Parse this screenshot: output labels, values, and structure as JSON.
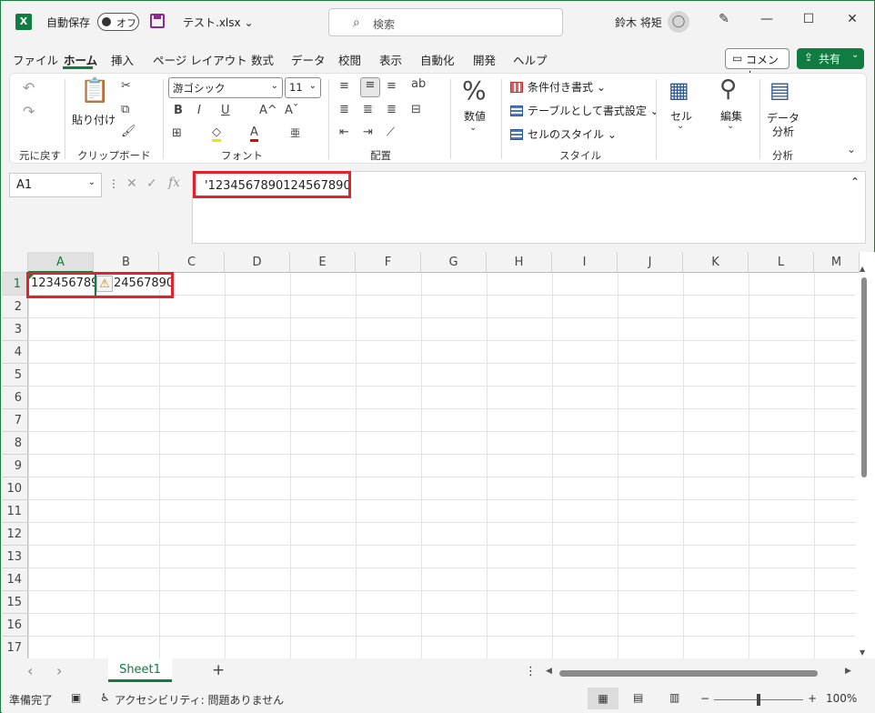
{
  "app": {
    "logo": "X",
    "autosave_label": "自動保存",
    "autosave_state": "オフ",
    "filename": "テスト.xlsx",
    "filename_chevron": "⌄",
    "search_placeholder": "検索",
    "user_name": "鈴木 将矩",
    "minimize": "—",
    "maximize": "☐",
    "close": "✕"
  },
  "menu": {
    "tabs": [
      "ファイル",
      "ホーム",
      "挿入",
      "ページ レイアウト",
      "数式",
      "データ",
      "校閲",
      "表示",
      "自動化",
      "開発",
      "ヘルプ"
    ],
    "active_tab": "ホーム",
    "comment_button": "コメント",
    "share_button": "共有"
  },
  "ribbon": {
    "groups": {
      "undo": "元に戻す",
      "clipboard": "クリップボード",
      "font": "フォント",
      "alignment": "配置",
      "styles": "スタイル",
      "analysis": "分析"
    },
    "paste_label": "貼り付け",
    "font_name": "游ゴシック",
    "font_size": "11",
    "bold": "B",
    "italic": "I",
    "underline": "U",
    "grow_font": "A^",
    "shrink_font": "Aˇ",
    "number_label": "数値",
    "number_symbol": "%",
    "conditional_format": "条件付き書式",
    "format_as_table": "テーブルとして書式設定",
    "cell_styles": "セルのスタイル",
    "cells_label": "セル",
    "edit_label": "編集",
    "data_analysis_label1": "データ",
    "data_analysis_label2": "分析"
  },
  "formula_bar": {
    "name_box": "A1",
    "fx": "fx",
    "cancel": "✕",
    "enter": "✓",
    "formula": "'1234567890124567890"
  },
  "grid": {
    "columns": [
      "A",
      "B",
      "C",
      "D",
      "E",
      "F",
      "G",
      "H",
      "I",
      "J",
      "K",
      "L",
      "M"
    ],
    "rows": [
      "1",
      "2",
      "3",
      "4",
      "5",
      "6",
      "7",
      "8",
      "9",
      "10",
      "11",
      "12",
      "13",
      "14",
      "15",
      "16",
      "17"
    ],
    "cell_a1_visible": "123456789",
    "cell_overflow_visible": "24567890",
    "warning_symbol": "⚠"
  },
  "sheets": {
    "tabs": [
      "Sheet1"
    ],
    "add": "+",
    "prev": "‹",
    "next": "›",
    "more": "⋮"
  },
  "status": {
    "ready": "準備完了",
    "accessibility": "アクセシビリティ: 問題ありません",
    "zoom": "100%",
    "zoom_minus": "−",
    "zoom_plus": "+"
  },
  "colors": {
    "accent": "#107c41",
    "highlight": "#e3232c"
  }
}
